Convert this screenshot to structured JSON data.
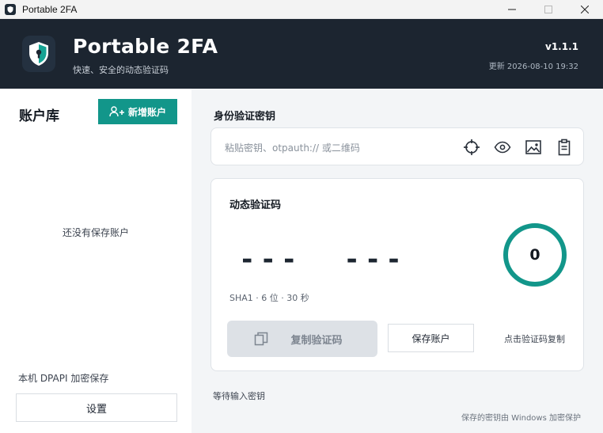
{
  "window": {
    "title": "Portable 2FA",
    "controls": [
      "minimize",
      "maximize",
      "close"
    ]
  },
  "header": {
    "app_name": "Portable 2FA",
    "subtitle": "快速、安全的动态验证码",
    "version": "v1.1.1",
    "updated": "更新 2026-08-10 19:32"
  },
  "sidebar": {
    "title": "账户库",
    "add_button": "新增账户",
    "empty_text": "还没有保存账户",
    "storage_note": "本机 DPAPI 加密保存",
    "settings_button": "设置"
  },
  "secret": {
    "label": "身份验证密钥",
    "placeholder": "粘贴密钥、otpauth:// 或二维码",
    "icons": [
      "crosshair-icon",
      "eye-icon",
      "image-icon",
      "clipboard-icon"
    ]
  },
  "otp": {
    "title": "动态验证码",
    "code": "---  ---",
    "countdown": "0",
    "meta": "SHA1 · 6 位 · 30 秒",
    "copy_button": "复制验证码",
    "save_button": "保存账户",
    "hint": "点击验证码复制"
  },
  "status": "等待输入密钥",
  "footer": "保存的密钥由 Windows 加密保护",
  "colors": {
    "accent": "#12968a",
    "header_bg": "#1c2530",
    "page_bg": "#f3f5f7"
  }
}
